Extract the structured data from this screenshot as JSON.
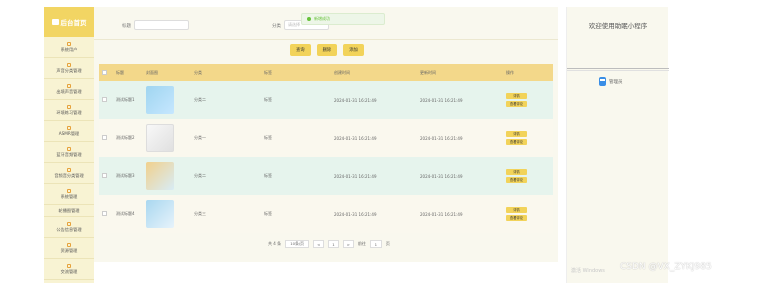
{
  "sidebar": {
    "brand": "后台首页",
    "items": [
      {
        "label": "系统用户",
        "plain": false
      },
      {
        "label": "声音分类管理",
        "plain": false
      },
      {
        "label": "出境声音管理",
        "plain": false
      },
      {
        "label": "环境练习管理",
        "plain": false
      },
      {
        "label": "ASMR管理",
        "plain": false
      },
      {
        "label": "蓝牙音频管理",
        "plain": false
      },
      {
        "label": "音频音分类管理",
        "plain": false
      },
      {
        "label": "系统管理",
        "plain": false
      },
      {
        "label": "轮播图管理",
        "plain": true
      },
      {
        "label": "公告信息管理",
        "plain": false
      },
      {
        "label": "资源管理",
        "plain": false
      },
      {
        "label": "交流管理",
        "plain": false
      },
      {
        "label": "论坛论坛",
        "plain": true
      }
    ]
  },
  "search": {
    "title_label": "标题",
    "category_label": "分类",
    "category_placeholder": "请选择"
  },
  "toast": "新增成功",
  "toolbar": {
    "search": "查询",
    "delete": "删除",
    "add": "添加"
  },
  "table": {
    "headers": [
      "",
      "标题",
      "封面图",
      "分类",
      "标签",
      "创建时间",
      "更新时间",
      "操作"
    ],
    "rows": [
      {
        "title": "测试标题1",
        "category": "分类二",
        "tag": "标签",
        "created": "2024-01-31 16:21:49",
        "updated": "2024-01-31 16:21:49",
        "thumb": "th0"
      },
      {
        "title": "测试标题2",
        "category": "分类一",
        "tag": "标签",
        "created": "2024-01-31 16:21:49",
        "updated": "2024-01-31 16:21:49",
        "thumb": "th1"
      },
      {
        "title": "测试标题3",
        "category": "分类二",
        "tag": "标签",
        "created": "2024-01-31 16:21:49",
        "updated": "2024-01-31 16:21:49",
        "thumb": "th2"
      },
      {
        "title": "测试标题4",
        "category": "分类三",
        "tag": "标签",
        "created": "2024-01-31 16:21:49",
        "updated": "2024-01-31 16:21:49",
        "thumb": "th3"
      }
    ],
    "op_detail": "详情",
    "op_comment": "查看评论"
  },
  "pager": {
    "total": "共 4 条",
    "size": "10条/页",
    "prev": "<",
    "page": "1",
    "next": ">",
    "goto": "前往",
    "goto_page": "1",
    "unit": "页"
  },
  "right": {
    "welcome": "欢迎使用助眠小程序",
    "manager": "管理员"
  },
  "activate": "激活 Windows",
  "watermark": "CSDN @VX_ZYKJ985"
}
